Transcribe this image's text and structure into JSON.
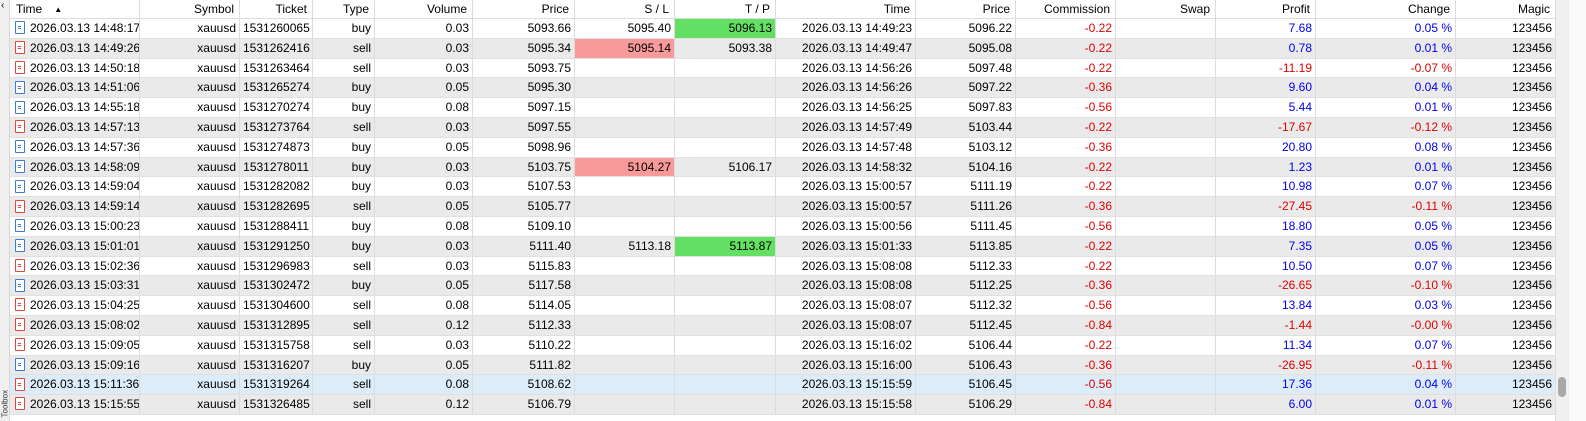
{
  "panel": {
    "side_label": "Toolbox"
  },
  "columns": [
    "Time",
    "Symbol",
    "Ticket",
    "Type",
    "Volume",
    "Price",
    "S / L",
    "T / P",
    "Time",
    "Price",
    "Commission",
    "Swap",
    "Profit",
    "Change",
    "Magic"
  ],
  "rows": [
    {
      "time": "2026.03.13 14:48:17",
      "symbol": "xauusd",
      "ticket": "1531260065",
      "type": "buy",
      "volume": "0.03",
      "price": "5093.66",
      "sl": "5095.40",
      "tp": "5096.13",
      "close_time": "2026.03.13 14:49:23",
      "close_price": "5096.22",
      "commission": "-0.22",
      "swap": "",
      "profit": "7.68",
      "change": "0.05 %",
      "magic": "123456",
      "sl_hl": "",
      "tp_hl": "green"
    },
    {
      "time": "2026.03.13 14:49:26",
      "symbol": "xauusd",
      "ticket": "1531262416",
      "type": "sell",
      "volume": "0.03",
      "price": "5095.34",
      "sl": "5095.14",
      "tp": "5093.38",
      "close_time": "2026.03.13 14:49:47",
      "close_price": "5095.08",
      "commission": "-0.22",
      "swap": "",
      "profit": "0.78",
      "change": "0.01 %",
      "magic": "123456",
      "sl_hl": "red",
      "tp_hl": ""
    },
    {
      "time": "2026.03.13 14:50:18",
      "symbol": "xauusd",
      "ticket": "1531263464",
      "type": "sell",
      "volume": "0.03",
      "price": "5093.75",
      "sl": "",
      "tp": "",
      "close_time": "2026.03.13 14:56:26",
      "close_price": "5097.48",
      "commission": "-0.22",
      "swap": "",
      "profit": "-11.19",
      "change": "-0.07 %",
      "magic": "123456",
      "sl_hl": "",
      "tp_hl": ""
    },
    {
      "time": "2026.03.13 14:51:06",
      "symbol": "xauusd",
      "ticket": "1531265274",
      "type": "buy",
      "volume": "0.05",
      "price": "5095.30",
      "sl": "",
      "tp": "",
      "close_time": "2026.03.13 14:56:26",
      "close_price": "5097.22",
      "commission": "-0.36",
      "swap": "",
      "profit": "9.60",
      "change": "0.04 %",
      "magic": "123456",
      "sl_hl": "",
      "tp_hl": ""
    },
    {
      "time": "2026.03.13 14:55:18",
      "symbol": "xauusd",
      "ticket": "1531270274",
      "type": "buy",
      "volume": "0.08",
      "price": "5097.15",
      "sl": "",
      "tp": "",
      "close_time": "2026.03.13 14:56:25",
      "close_price": "5097.83",
      "commission": "-0.56",
      "swap": "",
      "profit": "5.44",
      "change": "0.01 %",
      "magic": "123456",
      "sl_hl": "",
      "tp_hl": ""
    },
    {
      "time": "2026.03.13 14:57:13",
      "symbol": "xauusd",
      "ticket": "1531273764",
      "type": "sell",
      "volume": "0.03",
      "price": "5097.55",
      "sl": "",
      "tp": "",
      "close_time": "2026.03.13 14:57:49",
      "close_price": "5103.44",
      "commission": "-0.22",
      "swap": "",
      "profit": "-17.67",
      "change": "-0.12 %",
      "magic": "123456",
      "sl_hl": "",
      "tp_hl": ""
    },
    {
      "time": "2026.03.13 14:57:36",
      "symbol": "xauusd",
      "ticket": "1531274873",
      "type": "buy",
      "volume": "0.05",
      "price": "5098.96",
      "sl": "",
      "tp": "",
      "close_time": "2026.03.13 14:57:48",
      "close_price": "5103.12",
      "commission": "-0.36",
      "swap": "",
      "profit": "20.80",
      "change": "0.08 %",
      "magic": "123456",
      "sl_hl": "",
      "tp_hl": ""
    },
    {
      "time": "2026.03.13 14:58:09",
      "symbol": "xauusd",
      "ticket": "1531278011",
      "type": "buy",
      "volume": "0.03",
      "price": "5103.75",
      "sl": "5104.27",
      "tp": "5106.17",
      "close_time": "2026.03.13 14:58:32",
      "close_price": "5104.16",
      "commission": "-0.22",
      "swap": "",
      "profit": "1.23",
      "change": "0.01 %",
      "magic": "123456",
      "sl_hl": "red",
      "tp_hl": ""
    },
    {
      "time": "2026.03.13 14:59:04",
      "symbol": "xauusd",
      "ticket": "1531282082",
      "type": "buy",
      "volume": "0.03",
      "price": "5107.53",
      "sl": "",
      "tp": "",
      "close_time": "2026.03.13 15:00:57",
      "close_price": "5111.19",
      "commission": "-0.22",
      "swap": "",
      "profit": "10.98",
      "change": "0.07 %",
      "magic": "123456",
      "sl_hl": "",
      "tp_hl": ""
    },
    {
      "time": "2026.03.13 14:59:14",
      "symbol": "xauusd",
      "ticket": "1531282695",
      "type": "sell",
      "volume": "0.05",
      "price": "5105.77",
      "sl": "",
      "tp": "",
      "close_time": "2026.03.13 15:00:57",
      "close_price": "5111.26",
      "commission": "-0.36",
      "swap": "",
      "profit": "-27.45",
      "change": "-0.11 %",
      "magic": "123456",
      "sl_hl": "",
      "tp_hl": ""
    },
    {
      "time": "2026.03.13 15:00:23",
      "symbol": "xauusd",
      "ticket": "1531288411",
      "type": "buy",
      "volume": "0.08",
      "price": "5109.10",
      "sl": "",
      "tp": "",
      "close_time": "2026.03.13 15:00:56",
      "close_price": "5111.45",
      "commission": "-0.56",
      "swap": "",
      "profit": "18.80",
      "change": "0.05 %",
      "magic": "123456",
      "sl_hl": "",
      "tp_hl": ""
    },
    {
      "time": "2026.03.13 15:01:01",
      "symbol": "xauusd",
      "ticket": "1531291250",
      "type": "buy",
      "volume": "0.03",
      "price": "5111.40",
      "sl": "5113.18",
      "tp": "5113.87",
      "close_time": "2026.03.13 15:01:33",
      "close_price": "5113.85",
      "commission": "-0.22",
      "swap": "",
      "profit": "7.35",
      "change": "0.05 %",
      "magic": "123456",
      "sl_hl": "",
      "tp_hl": "green"
    },
    {
      "time": "2026.03.13 15:02:36",
      "symbol": "xauusd",
      "ticket": "1531296983",
      "type": "sell",
      "volume": "0.03",
      "price": "5115.83",
      "sl": "",
      "tp": "",
      "close_time": "2026.03.13 15:08:08",
      "close_price": "5112.33",
      "commission": "-0.22",
      "swap": "",
      "profit": "10.50",
      "change": "0.07 %",
      "magic": "123456",
      "sl_hl": "",
      "tp_hl": ""
    },
    {
      "time": "2026.03.13 15:03:31",
      "symbol": "xauusd",
      "ticket": "1531302472",
      "type": "buy",
      "volume": "0.05",
      "price": "5117.58",
      "sl": "",
      "tp": "",
      "close_time": "2026.03.13 15:08:08",
      "close_price": "5112.25",
      "commission": "-0.36",
      "swap": "",
      "profit": "-26.65",
      "change": "-0.10 %",
      "magic": "123456",
      "sl_hl": "",
      "tp_hl": ""
    },
    {
      "time": "2026.03.13 15:04:25",
      "symbol": "xauusd",
      "ticket": "1531304600",
      "type": "sell",
      "volume": "0.08",
      "price": "5114.05",
      "sl": "",
      "tp": "",
      "close_time": "2026.03.13 15:08:07",
      "close_price": "5112.32",
      "commission": "-0.56",
      "swap": "",
      "profit": "13.84",
      "change": "0.03 %",
      "magic": "123456",
      "sl_hl": "",
      "tp_hl": ""
    },
    {
      "time": "2026.03.13 15:08:02",
      "symbol": "xauusd",
      "ticket": "1531312895",
      "type": "sell",
      "volume": "0.12",
      "price": "5112.33",
      "sl": "",
      "tp": "",
      "close_time": "2026.03.13 15:08:07",
      "close_price": "5112.45",
      "commission": "-0.84",
      "swap": "",
      "profit": "-1.44",
      "change": "-0.00 %",
      "magic": "123456",
      "sl_hl": "",
      "tp_hl": ""
    },
    {
      "time": "2026.03.13 15:09:05",
      "symbol": "xauusd",
      "ticket": "1531315758",
      "type": "sell",
      "volume": "0.03",
      "price": "5110.22",
      "sl": "",
      "tp": "",
      "close_time": "2026.03.13 15:16:02",
      "close_price": "5106.44",
      "commission": "-0.22",
      "swap": "",
      "profit": "11.34",
      "change": "0.07 %",
      "magic": "123456",
      "sl_hl": "",
      "tp_hl": ""
    },
    {
      "time": "2026.03.13 15:09:16",
      "symbol": "xauusd",
      "ticket": "1531316207",
      "type": "buy",
      "volume": "0.05",
      "price": "5111.82",
      "sl": "",
      "tp": "",
      "close_time": "2026.03.13 15:16:00",
      "close_price": "5106.43",
      "commission": "-0.36",
      "swap": "",
      "profit": "-26.95",
      "change": "-0.11 %",
      "magic": "123456",
      "sl_hl": "",
      "tp_hl": ""
    },
    {
      "time": "2026.03.13 15:11:36",
      "symbol": "xauusd",
      "ticket": "1531319264",
      "type": "sell",
      "volume": "0.08",
      "price": "5108.62",
      "sl": "",
      "tp": "",
      "close_time": "2026.03.13 15:15:59",
      "close_price": "5106.45",
      "commission": "-0.56",
      "swap": "",
      "profit": "17.36",
      "change": "0.04 %",
      "magic": "123456",
      "sl_hl": "",
      "tp_hl": "",
      "selected": true
    },
    {
      "time": "2026.03.13 15:15:55",
      "symbol": "xauusd",
      "ticket": "1531326485",
      "type": "sell",
      "volume": "0.12",
      "price": "5106.79",
      "sl": "",
      "tp": "",
      "close_time": "2026.03.13 15:15:58",
      "close_price": "5106.29",
      "commission": "-0.84",
      "swap": "",
      "profit": "6.00",
      "change": "0.01 %",
      "magic": "123456",
      "sl_hl": "",
      "tp_hl": ""
    }
  ],
  "colors": {
    "buy_icon": "#3a7bd5",
    "sell_icon": "#e0473a",
    "sl_highlight": "#f99a9a",
    "tp_highlight": "#63e063",
    "negative": "#e00000",
    "positive": "#0000ee"
  },
  "icons": {
    "sort": "sort-ascending-icon",
    "position": "document-icon"
  }
}
